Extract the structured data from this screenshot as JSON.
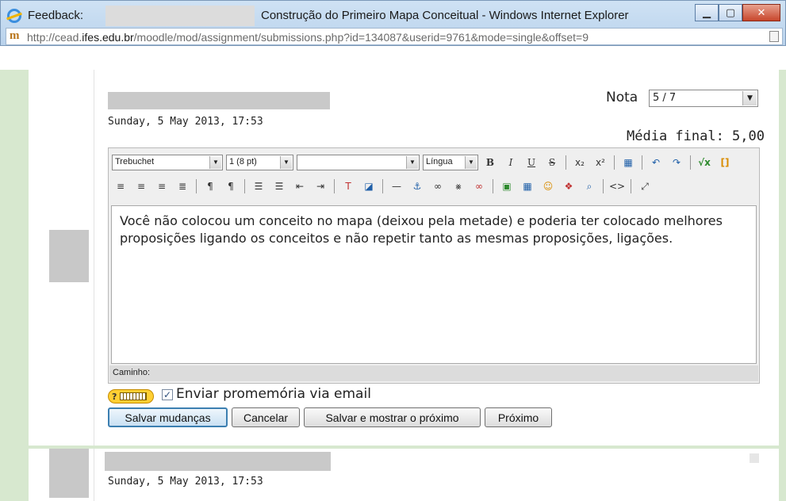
{
  "window": {
    "title_prefix": "Feedback:",
    "title": "Construção do Primeiro Mapa Conceitual - Windows Internet Explorer",
    "buttons": {
      "minimize": "▁",
      "maximize": "▢",
      "close": "✕"
    }
  },
  "address_bar": {
    "url_prefix": "http://cead.",
    "url_host": "ifes.edu.br",
    "url_path": "/moodle/mod/assignment/submissions.php?id=134087&userid=9761&mode=single&offset=9"
  },
  "submission": {
    "date": "Sunday, 5 May 2013, 17:53",
    "grade_label": "Nota",
    "grade_value": "5 / 7",
    "final_average": "Média final: 5,00"
  },
  "editor": {
    "font_family": "Trebuchet",
    "font_size": "1 (8 pt)",
    "heading": "",
    "language": "Língua",
    "content": "Você não colocou um conceito no mapa (deixou pela metade) e poderia ter colocado melhores proposições ligando os conceitos e não repetir tanto as mesmas proposições, ligações.",
    "path_label": "Caminho:"
  },
  "email_reminder": {
    "checked": true,
    "label": "Enviar promemória via email",
    "checkmark": "✓"
  },
  "actions": {
    "save": "Salvar mudanças",
    "cancel": "Cancelar",
    "save_next": "Salvar e mostrar o próximo",
    "next": "Próximo"
  },
  "next_submission": {
    "date": "Sunday, 5 May 2013, 17:53"
  },
  "icons": {
    "help": "?",
    "dropdown": "▼",
    "bold": "B",
    "italic": "I",
    "underline": "U",
    "strike": "S",
    "subscript": "x₂",
    "superscript": "x²",
    "undo": "↶",
    "redo": "↷",
    "tex": "√x",
    "nolink": "[]"
  }
}
